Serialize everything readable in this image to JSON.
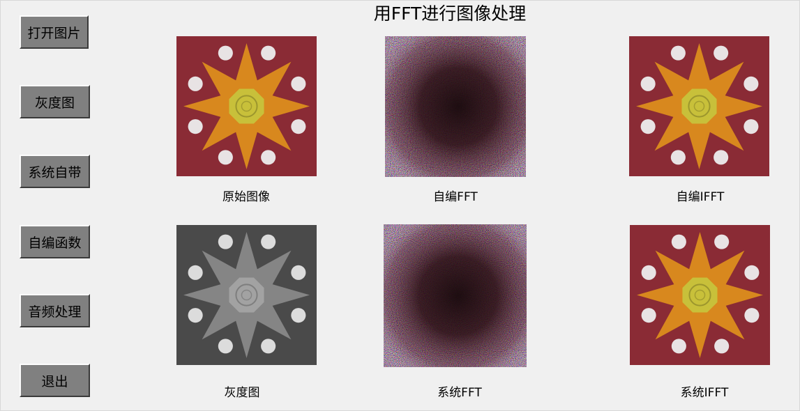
{
  "title": "用FFT进行图像处理",
  "buttons": {
    "open": "打开图片",
    "gray": "灰度图",
    "builtin": "系统自带",
    "custom": "自编函数",
    "audio": "音频处理",
    "exit": "退出"
  },
  "captions": {
    "original": "原始图像",
    "custom_fft": "自编FFT",
    "custom_ifft": "自编IFFT",
    "gray": "灰度图",
    "system_fft": "系统FFT",
    "system_ifft": "系统IFFT"
  },
  "colors": {
    "background": "#f0f0f0",
    "button_face": "#808080",
    "image_border": "#8a2b35",
    "image_star": "#d8881e",
    "image_center": "#c8c03a",
    "image_dot": "#e8e3e4",
    "gray_background": "#4a4a4a",
    "gray_star": "#858585",
    "gray_center": "#a2a2a2",
    "gray_dot": "#dcdcdc"
  }
}
